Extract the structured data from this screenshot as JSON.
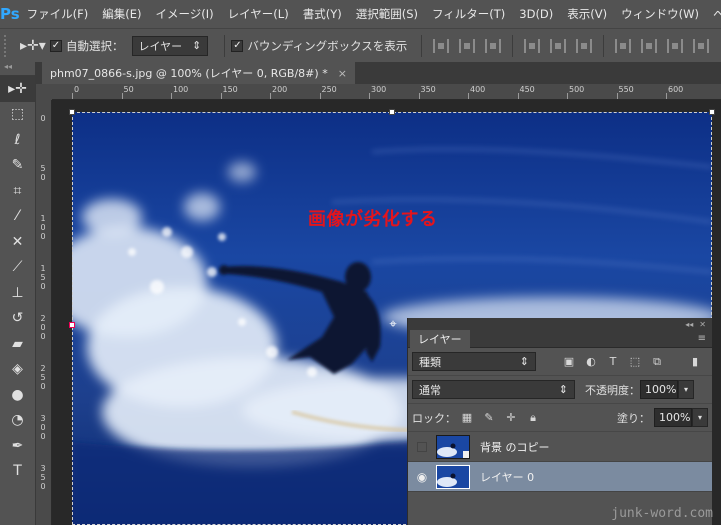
{
  "app": {
    "logo": "Ps"
  },
  "menu": [
    "ファイル(F)",
    "編集(E)",
    "イメージ(I)",
    "レイヤー(L)",
    "書式(Y)",
    "選択範囲(S)",
    "フィルター(T)",
    "3D(D)",
    "表示(V)",
    "ウィンドウ(W)",
    "ヘル"
  ],
  "options": {
    "auto_select_label": "自動選択：",
    "auto_select_value": "レイヤー",
    "bounding_box_label": "バウンディングボックスを表示"
  },
  "document": {
    "tab_title": "phm07_0866-s.jpg @ 100% (レイヤー 0, RGB/8#) *",
    "close_glyph": "×"
  },
  "ruler": {
    "top_labels": [
      "0",
      "50",
      "100",
      "150",
      "200",
      "250",
      "300",
      "350",
      "400",
      "450",
      "500",
      "550",
      "600"
    ],
    "left_labels": [
      "0",
      "50",
      "100",
      "150",
      "200",
      "250",
      "300",
      "350"
    ]
  },
  "annotation": {
    "text": "画像が劣化する",
    "color": "#e4141c"
  },
  "layers_panel": {
    "tab_label": "レイヤー",
    "filter_value": "種類",
    "blend_mode": "通常",
    "opacity_label": "不透明度：",
    "opacity_value": "100%",
    "lock_label": "ロック：",
    "fill_label": "塗り：",
    "fill_value": "100%",
    "layers": [
      {
        "name": "背景 のコピー",
        "visible": false,
        "selected": false
      },
      {
        "name": "レイヤー 0",
        "visible": true,
        "selected": true
      }
    ]
  },
  "watermark": "junk-word.com",
  "colors": {
    "ui_bg": "#535353",
    "ui_dark": "#3a3a3a",
    "selection": "#7b8ba0",
    "ps_blue": "#31a8ff"
  }
}
